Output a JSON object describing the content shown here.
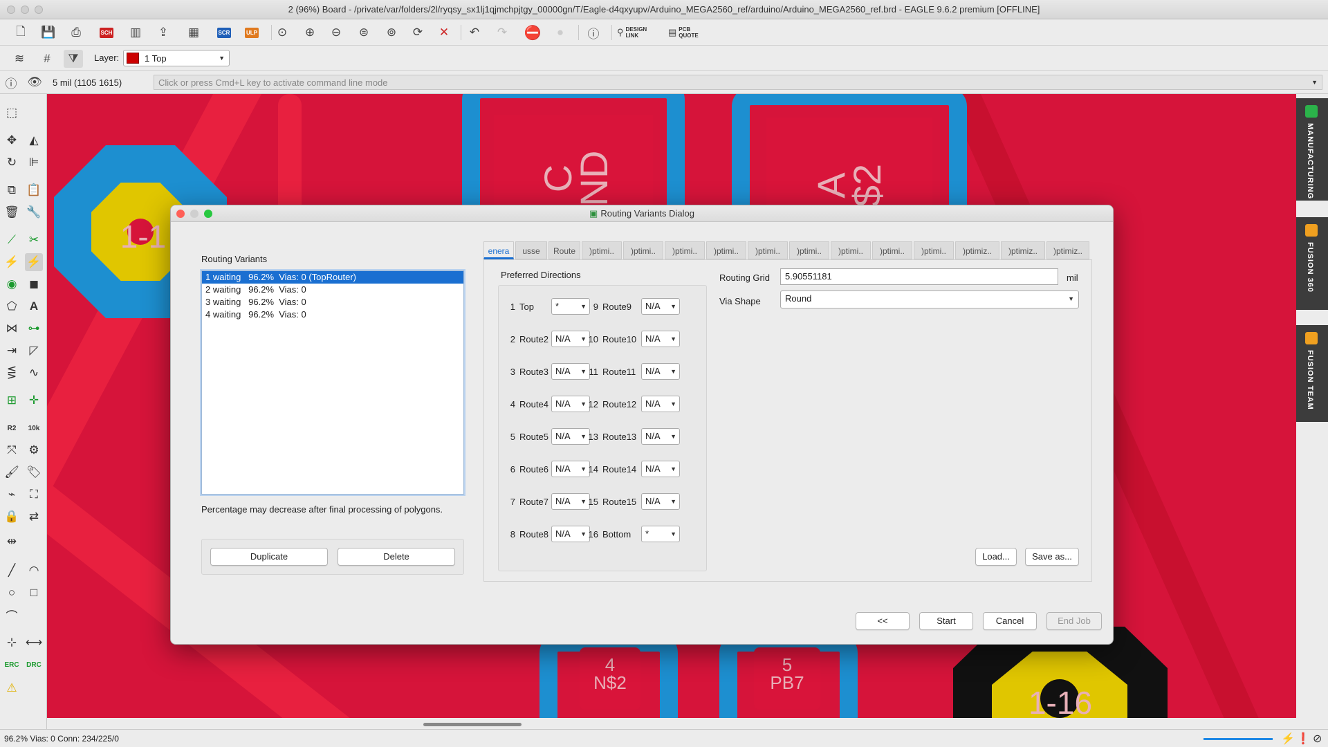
{
  "window": {
    "title": "2 (96%) Board - /private/var/folders/2l/ryqsy_sx1lj1qjmchpjtgy_00000gn/T/Eagle-d4qxyupv/Arduino_MEGA2560_ref/arduino/Arduino_MEGA2560_ref.brd - EAGLE 9.6.2 premium [OFFLINE]"
  },
  "toolbar": {
    "sch_label": "SCH",
    "scr_label": "SCR",
    "ulp_label": "ULP",
    "design_link": "DESIGN\nLINK",
    "pcb_quote": "PCB\nQUOTE",
    "layer_label": "Layer:",
    "layer_value": "1 Top",
    "layer_color": "#cc0000"
  },
  "command": {
    "coordinates": "5 mil (1105 1615)",
    "placeholder": "Click or press Cmd+L key to activate command line mode"
  },
  "canvas": {
    "pads": [
      "1-1",
      "C\nND",
      "A\n$2",
      "4\nN$2",
      "5\nPB7",
      "1-16"
    ]
  },
  "right_tabs": [
    "MANUFACTURING",
    "FUSION 360",
    "FUSION TEAM"
  ],
  "status": {
    "text": "96.2%  Vias: 0  Conn: 234/225/0"
  },
  "dialog": {
    "title": "Routing Variants Dialog",
    "variants_label": "Routing Variants",
    "variants": [
      "1 waiting   96.2%  Vias: 0 (TopRouter)",
      "2 waiting   96.2%  Vias: 0",
      "3 waiting   96.2%  Vias: 0",
      "4 waiting   96.2%  Vias: 0"
    ],
    "note": "Percentage may decrease after final processing of polygons.",
    "duplicate": "Duplicate",
    "delete": "Delete",
    "tabs": [
      "enera",
      "usse",
      "Route",
      ")ptimi..",
      ")ptimi..",
      ")ptimi..",
      ")ptimi..",
      ")ptimi..",
      ")ptimi..",
      ")ptimi..",
      ")ptimi..",
      ")ptimi..",
      ")ptimiz..",
      ")ptimiz..",
      ")ptimiz.."
    ],
    "preferred_directions": "Preferred Directions",
    "layers_left": [
      {
        "num": "1",
        "name": "Top",
        "value": "*"
      },
      {
        "num": "2",
        "name": "Route2",
        "value": "N/A"
      },
      {
        "num": "3",
        "name": "Route3",
        "value": "N/A"
      },
      {
        "num": "4",
        "name": "Route4",
        "value": "N/A"
      },
      {
        "num": "5",
        "name": "Route5",
        "value": "N/A"
      },
      {
        "num": "6",
        "name": "Route6",
        "value": "N/A"
      },
      {
        "num": "7",
        "name": "Route7",
        "value": "N/A"
      },
      {
        "num": "8",
        "name": "Route8",
        "value": "N/A"
      }
    ],
    "layers_right": [
      {
        "num": "9",
        "name": "Route9",
        "value": "N/A"
      },
      {
        "num": "10",
        "name": "Route10",
        "value": "N/A"
      },
      {
        "num": "11",
        "name": "Route11",
        "value": "N/A"
      },
      {
        "num": "12",
        "name": "Route12",
        "value": "N/A"
      },
      {
        "num": "13",
        "name": "Route13",
        "value": "N/A"
      },
      {
        "num": "14",
        "name": "Route14",
        "value": "N/A"
      },
      {
        "num": "15",
        "name": "Route15",
        "value": "N/A"
      },
      {
        "num": "16",
        "name": "Bottom",
        "value": "*"
      }
    ],
    "routing_grid_label": "Routing Grid",
    "routing_grid_value": "5.90551181",
    "routing_grid_unit": "mil",
    "via_shape_label": "Via Shape",
    "via_shape_value": "Round",
    "load": "Load...",
    "save_as": "Save as...",
    "back": "<<",
    "start": "Start",
    "cancel": "Cancel",
    "end_job": "End Job"
  }
}
